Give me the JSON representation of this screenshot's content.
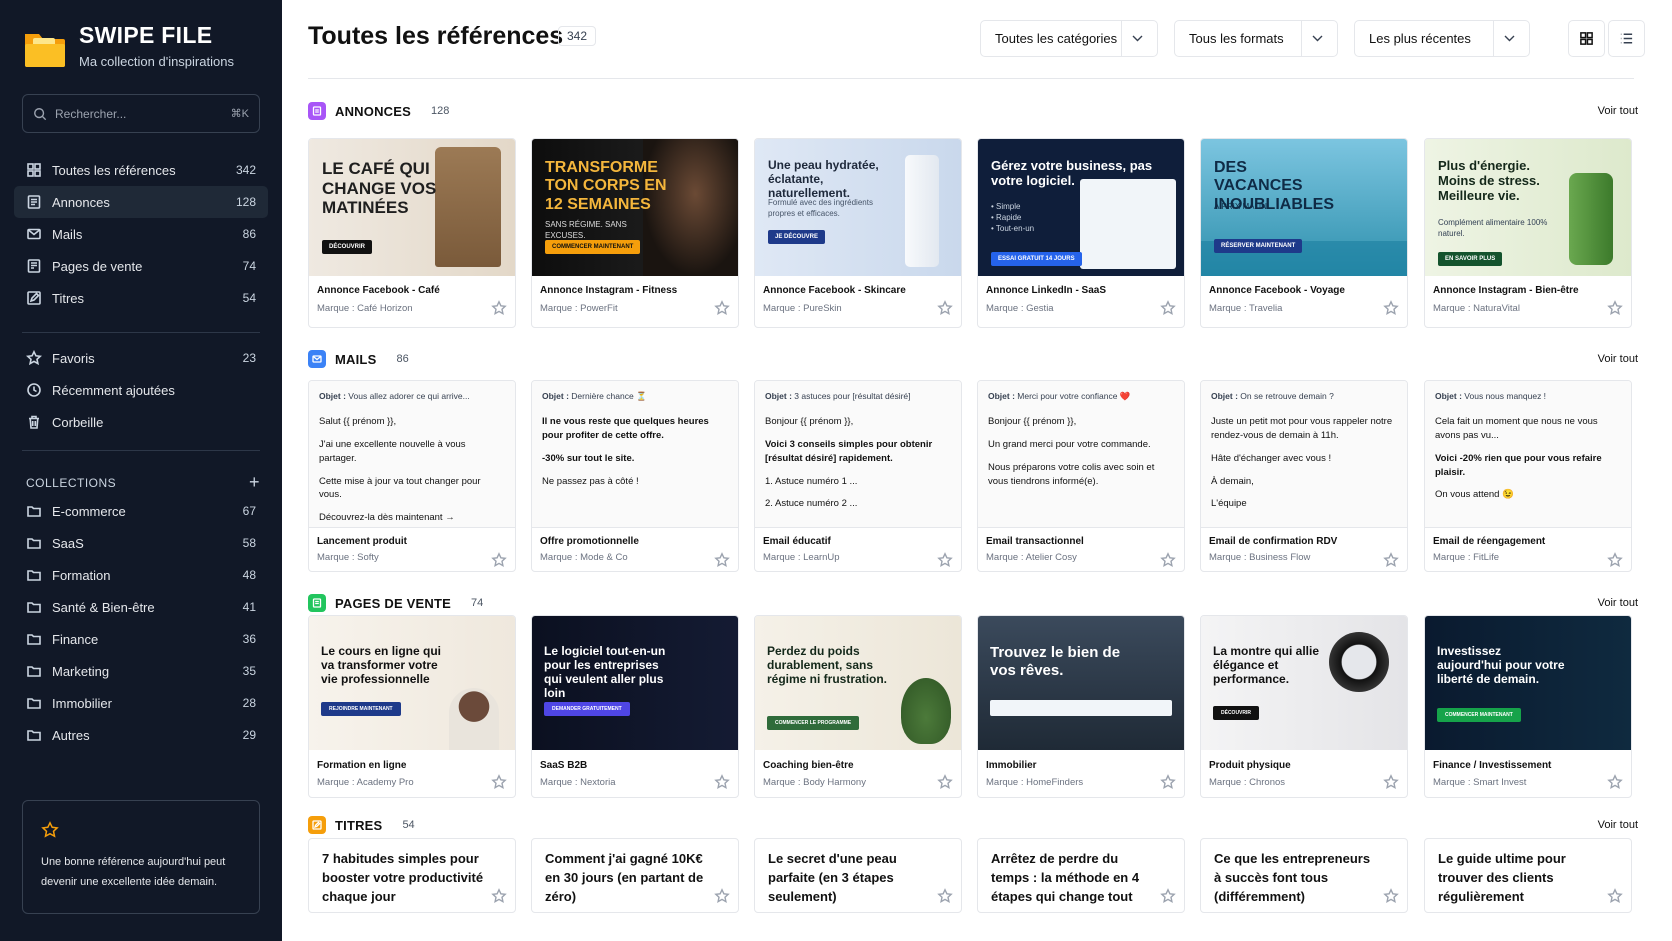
{
  "app": {
    "name": "SWIPE FILE",
    "tagline": "Ma collection d'inspirations"
  },
  "search": {
    "placeholder": "Rechercher...",
    "shortcut": "⌘K"
  },
  "nav": [
    {
      "label": "Toutes les références",
      "count": "342",
      "icon": "grid-icon"
    },
    {
      "label": "Annonces",
      "count": "128",
      "icon": "ad-icon"
    },
    {
      "label": "Mails",
      "count": "86",
      "icon": "mail-icon"
    },
    {
      "label": "Pages de vente",
      "count": "74",
      "icon": "page-icon"
    },
    {
      "label": "Titres",
      "count": "54",
      "icon": "edit-icon"
    }
  ],
  "nav2": [
    {
      "label": "Favoris",
      "count": "23",
      "icon": "star-icon"
    },
    {
      "label": "Récemment ajoutées",
      "count": "",
      "icon": "clock-icon"
    },
    {
      "label": "Corbeille",
      "count": "",
      "icon": "trash-icon"
    }
  ],
  "collections": {
    "heading": "COLLECTIONS",
    "items": [
      {
        "label": "E-commerce",
        "count": "67"
      },
      {
        "label": "SaaS",
        "count": "58"
      },
      {
        "label": "Formation",
        "count": "48"
      },
      {
        "label": "Santé & Bien-être",
        "count": "41"
      },
      {
        "label": "Finance",
        "count": "36"
      },
      {
        "label": "Marketing",
        "count": "35"
      },
      {
        "label": "Immobilier",
        "count": "28"
      },
      {
        "label": "Autres",
        "count": "29"
      }
    ]
  },
  "tip": "Une bonne référence aujourd'hui peut devenir une excellente idée demain.",
  "header": {
    "title": "Toutes les références",
    "count": "342",
    "filters": [
      "Toutes les catégories",
      "Tous les formats",
      "Les plus récentes"
    ]
  },
  "sections": {
    "annonces": {
      "title": "ANNONCES",
      "count": "128",
      "more": "Voir tout"
    },
    "mails": {
      "title": "MAILS",
      "count": "86",
      "more": "Voir tout"
    },
    "pages": {
      "title": "PAGES DE VENTE",
      "count": "74",
      "more": "Voir tout"
    },
    "titres": {
      "title": "TITRES",
      "count": "54",
      "more": "Voir tout"
    }
  },
  "ads": [
    {
      "name": "Annonce Facebook - Café",
      "brand": "Marque : Café Horizon",
      "headline": "LE CAFÉ QUI CHANGE VOS MATINÉES",
      "cta": "DÉCOUVRIR",
      "sub": ""
    },
    {
      "name": "Annonce Instagram - Fitness",
      "brand": "Marque : PowerFit",
      "headline": "TRANSFORME TON CORPS EN 12 SEMAINES",
      "cta": "COMMENCER MAINTENANT",
      "sub": "SANS RÉGIME. SANS EXCUSES."
    },
    {
      "name": "Annonce Facebook - Skincare",
      "brand": "Marque : PureSkin",
      "headline": "Une peau hydratée, éclatante, naturellement.",
      "cta": "JE DÉCOUVRE",
      "sub": "Formulé avec des ingrédients propres et efficaces."
    },
    {
      "name": "Annonce LinkedIn - SaaS",
      "brand": "Marque : Gestia",
      "headline": "Gérez votre business, pas votre logiciel.",
      "cta": "ESSAI GRATUIT 14 JOURS",
      "sub": "• Simple\n• Rapide\n• Tout-en-un"
    },
    {
      "name": "Annonce Facebook - Voyage",
      "brand": "Marque : Travelia",
      "headline": "DES VACANCES INOUBLIABLES",
      "cta": "RÉSERVER MAINTENANT",
      "sub": "À PRIX MALIN"
    },
    {
      "name": "Annonce Instagram - Bien-être",
      "brand": "Marque : NaturaVital",
      "headline": "Plus d'énergie. Moins de stress. Meilleure vie.",
      "cta": "EN SAVOIR PLUS",
      "sub": "Complément alimentaire 100% naturel."
    }
  ],
  "mails": [
    {
      "name": "Lancement produit",
      "brand": "Marque : Softy",
      "obj_label": "Objet :",
      "obj": "Vous allez adorer ce qui arrive...",
      "lines": [
        "Salut {{ prénom }},",
        "J'ai une excellente nouvelle à vous partager.",
        "Cette mise à jour va tout changer pour vous.",
        "Découvrez-la dès maintenant →"
      ]
    },
    {
      "name": "Offre promotionnelle",
      "brand": "Marque : Mode & Co",
      "obj_label": "Objet :",
      "obj": "Dernière chance ⏳",
      "lines": [
        "Il ne vous reste que quelques heures pour profiter de cette offre.",
        "-30% sur tout le site.",
        "Ne passez pas à côté !"
      ]
    },
    {
      "name": "Email éducatif",
      "brand": "Marque : LearnUp",
      "obj_label": "Objet :",
      "obj": "3 astuces pour [résultat désiré]",
      "lines": [
        "Bonjour {{ prénom }},",
        "Voici 3 conseils simples pour obtenir [résultat désiré] rapidement.",
        "1. Astuce numéro 1 ...",
        "2. Astuce numéro 2 ..."
      ]
    },
    {
      "name": "Email transactionnel",
      "brand": "Marque : Atelier Cosy",
      "obj_label": "Objet :",
      "obj": "Merci pour votre confiance ❤️",
      "lines": [
        "Bonjour {{ prénom }},",
        "Un grand merci pour votre commande.",
        "Nous préparons votre colis avec soin et vous tiendrons informé(e)."
      ]
    },
    {
      "name": "Email de confirmation RDV",
      "brand": "Marque : Business Flow",
      "obj_label": "Objet :",
      "obj": "On se retrouve demain ?",
      "lines": [
        "Juste un petit mot pour vous rappeler notre rendez-vous de demain à 11h.",
        "Hâte d'échanger avec vous !",
        "À demain,",
        "L'équipe"
      ]
    },
    {
      "name": "Email de réengagement",
      "brand": "Marque : FitLife",
      "obj_label": "Objet :",
      "obj": "Vous nous manquez !",
      "lines": [
        "Cela fait un moment que nous ne vous avons pas vu...",
        "Voici -20% rien que pour vous refaire plaisir.",
        "On vous attend 😉"
      ]
    }
  ],
  "pages": [
    {
      "name": "Formation en ligne",
      "brand": "Marque : Academy Pro",
      "headline": "Le cours en ligne qui va transformer votre vie professionnelle",
      "cta": "REJOINDRE MAINTENANT"
    },
    {
      "name": "SaaS B2B",
      "brand": "Marque : Nextoria",
      "headline": "Le logiciel tout-en-un pour les entreprises qui veulent aller plus loin",
      "cta": "DEMANDER GRATUITEMENT"
    },
    {
      "name": "Coaching bien-être",
      "brand": "Marque : Body Harmony",
      "headline": "Perdez du poids durablement, sans régime ni frustration.",
      "cta": "COMMENCER LE PROGRAMME"
    },
    {
      "name": "Immobilier",
      "brand": "Marque : HomeFinders",
      "headline": "Trouvez le bien de vos rêves.",
      "cta": ""
    },
    {
      "name": "Produit physique",
      "brand": "Marque : Chronos",
      "headline": "La montre qui allie élégance et performance.",
      "cta": "DÉCOUVRIR"
    },
    {
      "name": "Finance / Investissement",
      "brand": "Marque : Smart Invest",
      "headline": "Investissez aujourd'hui pour votre liberté de demain.",
      "cta": "COMMENCER MAINTENANT"
    }
  ],
  "titles": [
    "7 habitudes simples pour booster votre productivité chaque jour",
    "Comment j'ai gagné 10K€ en 30 jours (en partant de zéro)",
    "Le secret d'une peau parfaite (en 3 étapes seulement)",
    "Arrêtez de perdre du temps : la méthode en 4 étapes qui change tout",
    "Ce que les entrepreneurs à succès font tous (différemment)",
    "Le guide ultime pour trouver des clients régulièrement"
  ],
  "colors": {
    "sidebar": "#111827",
    "annonces": "#a855f7",
    "mails": "#3b82f6",
    "pages": "#22c55e",
    "titres": "#f59e0b"
  }
}
